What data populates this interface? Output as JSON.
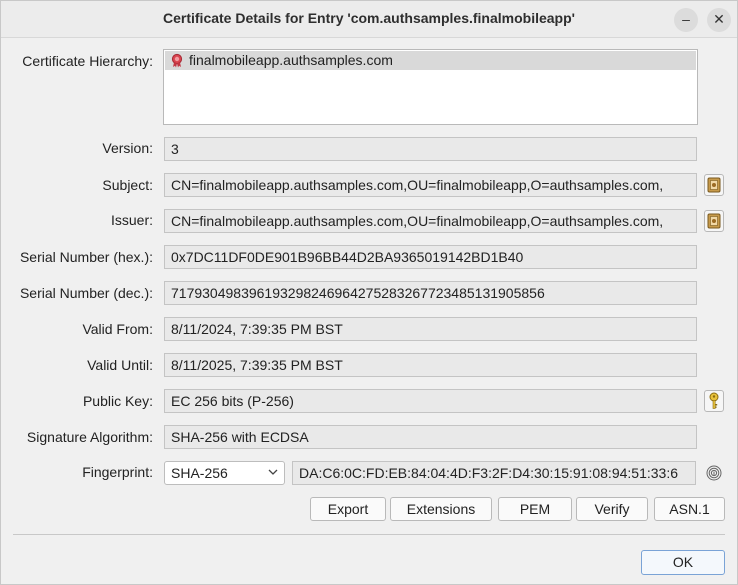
{
  "window": {
    "title": "Certificate Details for Entry 'com.authsamples.finalmobileapp'",
    "minimize_glyph": "–",
    "close_glyph": "✕"
  },
  "labels": {
    "hierarchy": "Certificate Hierarchy:",
    "version": "Version:",
    "subject": "Subject:",
    "issuer": "Issuer:",
    "serial_hex": "Serial Number (hex.):",
    "serial_dec": "Serial Number (dec.):",
    "valid_from": "Valid From:",
    "valid_until": "Valid Until:",
    "public_key": "Public Key:",
    "sig_alg": "Signature Algorithm:",
    "fingerprint": "Fingerprint:"
  },
  "hierarchy": {
    "items": [
      {
        "label": "finalmobileapp.authsamples.com",
        "icon": "certificate-icon"
      }
    ]
  },
  "values": {
    "version": "3",
    "subject": "CN=finalmobileapp.authsamples.com,OU=finalmobileapp,O=authsamples.com,",
    "issuer": "CN=finalmobileapp.authsamples.com,OU=finalmobileapp,O=authsamples.com,",
    "serial_hex": "0x7DC11DF0DE901B96BB44D2BA9365019142BD1B40",
    "serial_dec": "717930498396193298246964275283267723485131905856",
    "valid_from": "8/11/2024, 7:39:35 PM BST",
    "valid_until": "8/11/2025, 7:39:35 PM BST",
    "public_key": "EC 256 bits (P-256)",
    "sig_alg": "SHA-256 with ECDSA",
    "fingerprint_alg": "SHA-256",
    "fingerprint": "DA:C6:0C:FD:EB:84:04:4D:F3:2F:D4:30:15:91:08:94:51:33:6"
  },
  "buttons": {
    "export": "Export",
    "extensions": "Extensions",
    "pem": "PEM",
    "verify": "Verify",
    "asn1": "ASN.1",
    "ok": "OK"
  },
  "icons": {
    "subject_details": "certificate-details-icon",
    "issuer_details": "certificate-details-icon",
    "public_key_details": "key-icon",
    "fingerprint_copy": "fingerprint-icon"
  }
}
